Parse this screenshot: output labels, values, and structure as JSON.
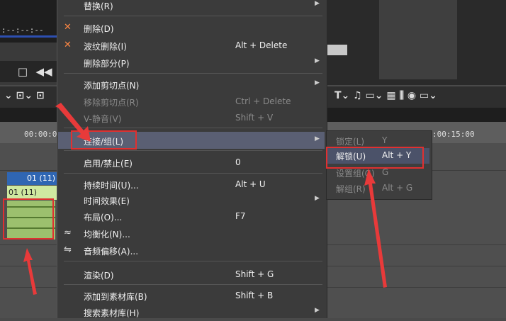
{
  "editor": {
    "timecode": ":--:--:--",
    "ruler_left": "00:00:0",
    "ruler_right": ":00:15:00",
    "clip_header": "01 (11)",
    "clip_video": "01 (11)",
    "ctrl_stop": "□",
    "ctrl_rewind": "◀◀",
    "toolbar_left": "⌄ ⊡⌄ ⊡",
    "toolbar_right": "T⌄ ♫ ▭⌄ ▦ ⫼ ◉ ▭⌄"
  },
  "menu": {
    "items": [
      {
        "label": "替换(R)",
        "shortcut": "",
        "arrow": "▶",
        "disabled": false
      },
      {
        "label": "删除(D)",
        "shortcut": "",
        "arrow": "",
        "disabled": false,
        "icon": "✕"
      },
      {
        "label": "波纹删除(I)",
        "shortcut": "Alt + Delete",
        "arrow": "",
        "disabled": false,
        "icon": "✕"
      },
      {
        "label": "删除部分(P)",
        "shortcut": "",
        "arrow": "▶",
        "disabled": false
      },
      {
        "label": "添加剪切点(N)",
        "shortcut": "",
        "arrow": "▶",
        "disabled": false
      },
      {
        "label": "移除剪切点(R)",
        "shortcut": "Ctrl + Delete",
        "arrow": "",
        "disabled": true
      },
      {
        "label": "V-静音(V)",
        "shortcut": "Shift + V",
        "arrow": "",
        "disabled": true
      },
      {
        "label": "连接/组(L)",
        "shortcut": "",
        "arrow": "▶",
        "disabled": false
      },
      {
        "label": "启用/禁止(E)",
        "shortcut": "0",
        "arrow": "",
        "disabled": false
      },
      {
        "label": "持续时间(U)...",
        "shortcut": "Alt + U",
        "arrow": "",
        "disabled": false
      },
      {
        "label": "时间效果(E)",
        "shortcut": "",
        "arrow": "▶",
        "disabled": false
      },
      {
        "label": "布局(O)...",
        "shortcut": "F7",
        "arrow": "",
        "disabled": false
      },
      {
        "label": "均衡化(N)...",
        "shortcut": "",
        "arrow": "",
        "disabled": false,
        "icon": "≈"
      },
      {
        "label": "音频偏移(A)...",
        "shortcut": "",
        "arrow": "",
        "disabled": false,
        "icon": "⇋"
      },
      {
        "label": "渲染(D)",
        "shortcut": "Shift + G",
        "arrow": "",
        "disabled": false
      },
      {
        "label": "添加到素材库(B)",
        "shortcut": "Shift + B",
        "arrow": "",
        "disabled": false
      },
      {
        "label": "搜索素材库(H)",
        "shortcut": "",
        "arrow": "▶",
        "disabled": false
      }
    ]
  },
  "submenu": {
    "items": [
      {
        "label": "锁定(L)",
        "shortcut": "Y",
        "disabled": true
      },
      {
        "label": "解锁(U)",
        "shortcut": "Alt + Y",
        "disabled": false
      },
      {
        "label": "设置组(G)",
        "shortcut": "G",
        "disabled": true
      },
      {
        "label": "解组(R)",
        "shortcut": "Alt + G",
        "disabled": true
      }
    ]
  },
  "colors": {
    "highlight_box": "#e03030",
    "menu_bg": "#3b3b3b",
    "arrow": "#e83a3a"
  }
}
